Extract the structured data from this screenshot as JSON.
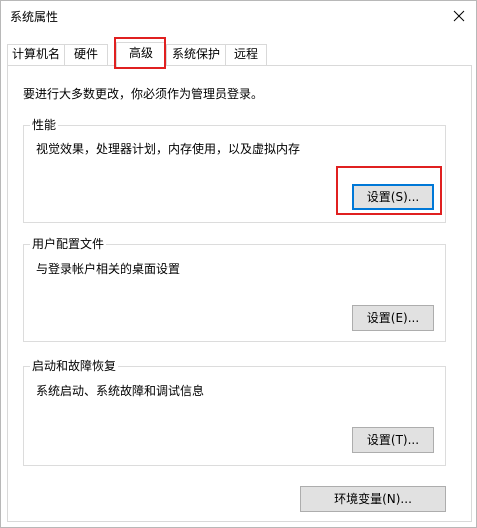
{
  "window": {
    "title": "系统属性"
  },
  "tabs": [
    {
      "label": "计算机名",
      "active": false
    },
    {
      "label": "硬件",
      "active": false
    },
    {
      "label": "高级",
      "active": true
    },
    {
      "label": "系统保护",
      "active": false
    },
    {
      "label": "远程",
      "active": false
    }
  ],
  "advanced": {
    "admin_note": "要进行大多数更改，你必须作为管理员登录。",
    "performance": {
      "label": "性能",
      "description": "视觉效果，处理器计划，内存使用，以及虚拟内存",
      "button": "设置(S)..."
    },
    "user_profiles": {
      "label": "用户配置文件",
      "description": "与登录帐户相关的桌面设置",
      "button": "设置(E)..."
    },
    "startup_recovery": {
      "label": "启动和故障恢复",
      "description": "系统启动、系统故障和调试信息",
      "button": "设置(T)..."
    },
    "env_button": "环境变量(N)..."
  },
  "colors": {
    "annotation_red": "#e02020",
    "default_button_border": "#0078d7",
    "button_face": "#e1e1e1"
  },
  "icons": {
    "close": "close-icon"
  }
}
